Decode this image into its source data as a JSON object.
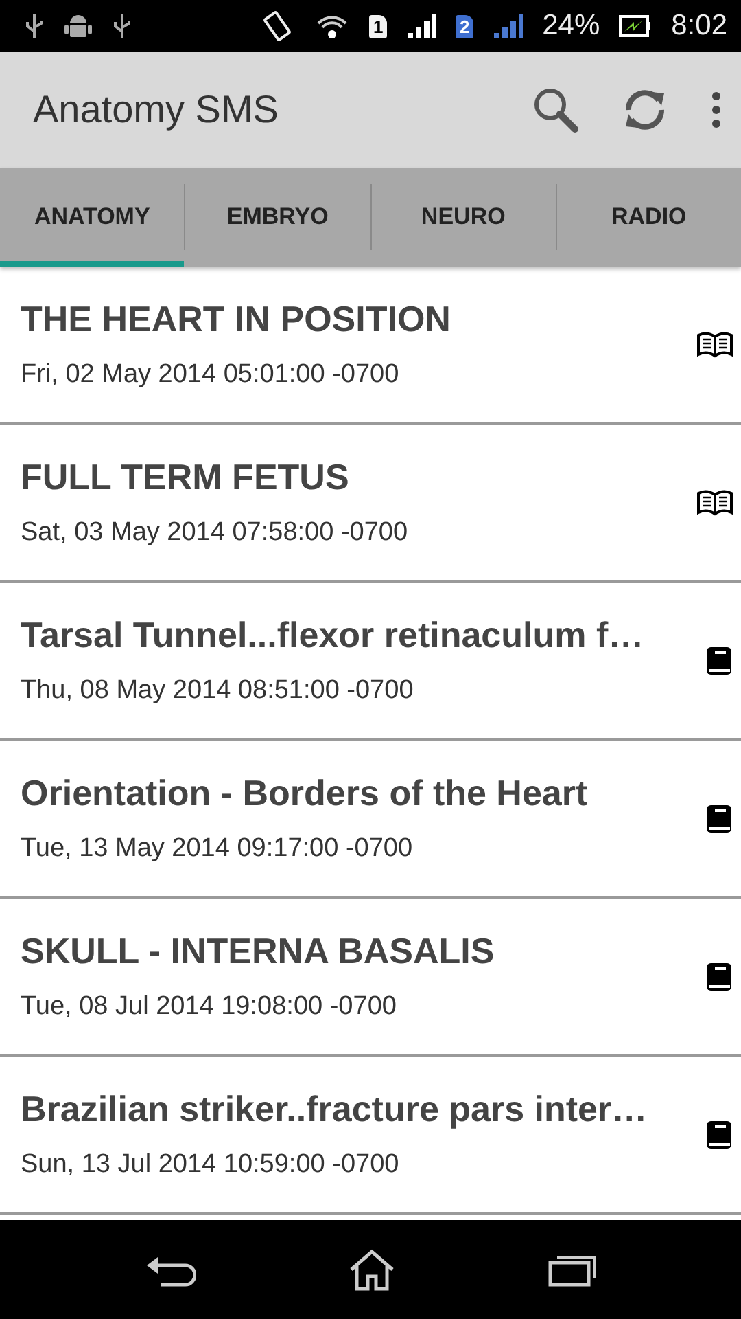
{
  "status_bar": {
    "sim_1": "1",
    "sim_2": "2",
    "battery": "24%",
    "time": "8:02"
  },
  "app_bar": {
    "title": "Anatomy SMS"
  },
  "tabs": [
    {
      "label": "ANATOMY",
      "selected": true
    },
    {
      "label": "EMBRYO",
      "selected": false
    },
    {
      "label": "NEURO",
      "selected": false
    },
    {
      "label": "RADIO",
      "selected": false
    }
  ],
  "messages": [
    {
      "title": "THE HEART IN POSITION",
      "date": "Fri, 02 May 2014 05:01:00 -0700",
      "read": true
    },
    {
      "title": "FULL TERM FETUS",
      "date": "Sat, 03 May 2014 07:58:00 -0700",
      "read": true
    },
    {
      "title": "Tarsal Tunnel...flexor retinaculum f…",
      "date": "Thu, 08 May 2014 08:51:00 -0700",
      "read": false
    },
    {
      "title": "Orientation - Borders of the Heart",
      "date": "Tue, 13 May 2014 09:17:00 -0700",
      "read": false
    },
    {
      "title": "SKULL - INTERNA BASALIS",
      "date": "Tue, 08 Jul 2014 19:08:00 -0700",
      "read": false
    },
    {
      "title": "Brazilian striker..fracture pars inter…",
      "date": "Sun, 13 Jul 2014 10:59:00 -0700",
      "read": false
    }
  ]
}
